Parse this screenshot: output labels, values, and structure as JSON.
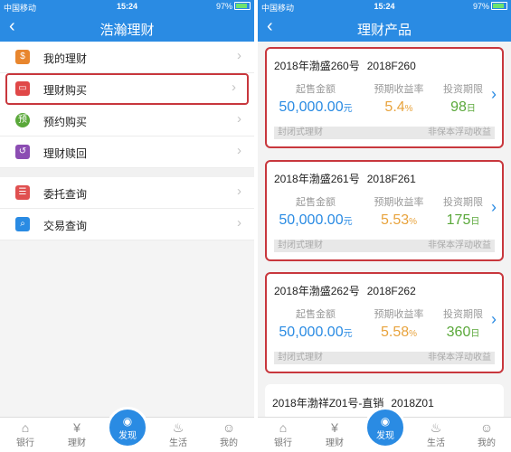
{
  "status": {
    "carrier": "中国移动",
    "time": "15:24",
    "battery": "97%"
  },
  "left": {
    "title": "浩瀚理财",
    "menu": [
      {
        "label": "我的理财",
        "icon": "money-bag-icon",
        "color": "#e8862e"
      },
      {
        "label": "理财购买",
        "icon": "wallet-icon",
        "color": "#e04848"
      },
      {
        "label": "预约购买",
        "icon": "reserve-icon",
        "color": "#5aa83a"
      },
      {
        "label": "理财赎回",
        "icon": "redeem-icon",
        "color": "#8c4db3"
      },
      {
        "label": "委托查询",
        "icon": "clipboard-icon",
        "color": "#e05050"
      },
      {
        "label": "交易查询",
        "icon": "search-transaction-icon",
        "color": "#2a8be3"
      }
    ]
  },
  "right": {
    "title": "理财产品",
    "labels": {
      "min_amount": "起售金额",
      "expected_rate": "预期收益率",
      "period": "投资期限"
    },
    "products": [
      {
        "name": "2018年渤盛260号",
        "code": "2018F260",
        "amount": "50,000.00",
        "amount_unit": "元",
        "rate": "5.4",
        "rate_unit": "%",
        "period": "98",
        "period_unit": "日",
        "tag_left": "封闭式理财",
        "tag_right": "非保本浮动收益"
      },
      {
        "name": "2018年渤盛261号",
        "code": "2018F261",
        "amount": "50,000.00",
        "amount_unit": "元",
        "rate": "5.53",
        "rate_unit": "%",
        "period": "175",
        "period_unit": "日",
        "tag_left": "封闭式理财",
        "tag_right": "非保本浮动收益"
      },
      {
        "name": "2018年渤盛262号",
        "code": "2018F262",
        "amount": "50,000.00",
        "amount_unit": "元",
        "rate": "5.58",
        "rate_unit": "%",
        "period": "360",
        "period_unit": "日",
        "tag_left": "封闭式理财",
        "tag_right": "非保本浮动收益"
      }
    ],
    "partial_product": {
      "name": "2018年渤祥Z01号-直销",
      "code": "2018Z01"
    }
  },
  "tabbar": {
    "bank": "银行",
    "finance": "理财",
    "discover": "发现",
    "life": "生活",
    "mine": "我的"
  },
  "colors": {
    "brand": "#2a8be3",
    "highlight": "#c8373d"
  }
}
